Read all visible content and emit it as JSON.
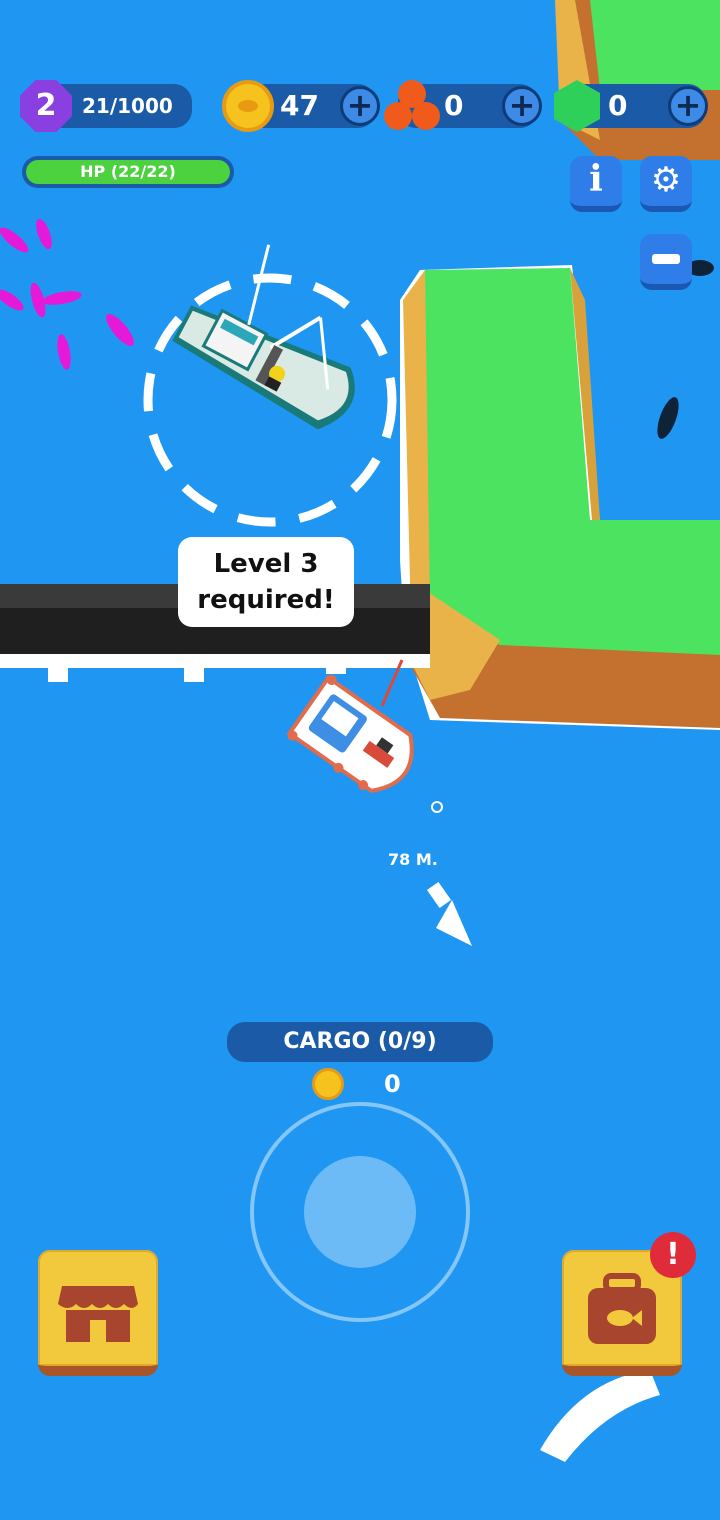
{
  "hud": {
    "level": "2",
    "xp": "21/1000",
    "coins": "47",
    "orbs": "0",
    "gems": "0",
    "hp_label": "HP (22/22)",
    "hp_fraction": 1.0
  },
  "bridge_notice": {
    "line1": "Level 3",
    "line2": "required!"
  },
  "distance": "78 M.",
  "cargo": {
    "label": "CARGO (0/9)",
    "coin_value": "0"
  },
  "colors": {
    "water": "#1f97f2",
    "grass": "#4be35f",
    "cliff": "#e9b34a",
    "hud_bg": "#1a5aa6",
    "hp_bar": "#4cd13f",
    "level_badge": "#8a3fe0",
    "coin": "#f6c21d",
    "orb": "#f05a1a",
    "gem": "#2fd05a",
    "alert": "#e02b3a"
  },
  "icons": {
    "shop": "shop-icon",
    "bag": "fish-bag-icon",
    "info": "info-icon",
    "settings": "gear-icon",
    "zoom_out": "minus-icon"
  },
  "alert_mark": "!"
}
